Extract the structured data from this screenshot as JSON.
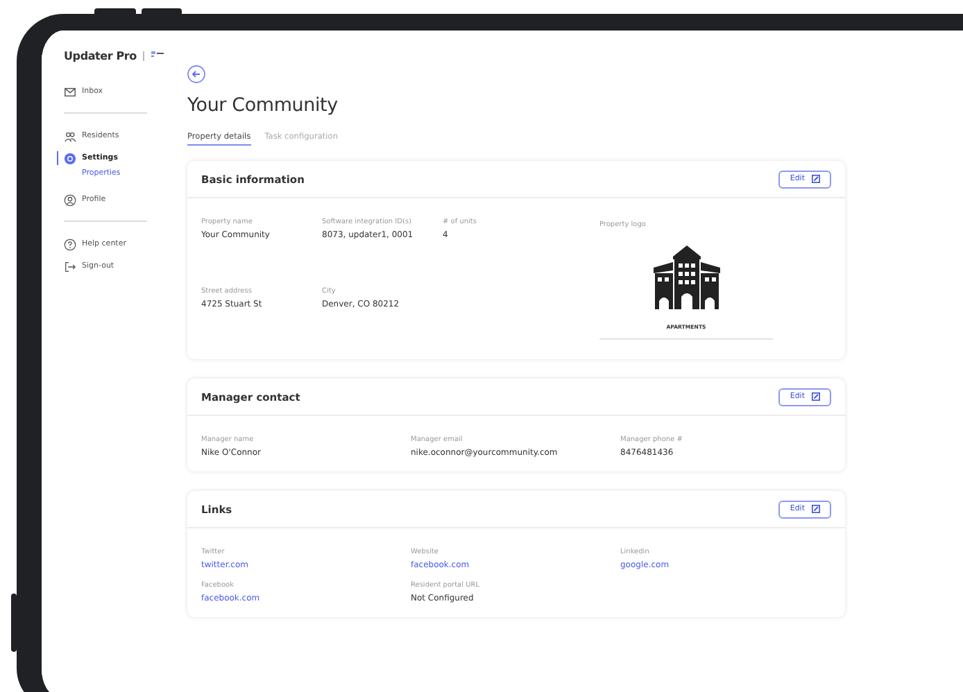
{
  "app": {
    "name": "Updater Pro"
  },
  "sidebar": {
    "groups": [
      [
        {
          "kind": "mail",
          "label": "Inbox",
          "selected": false
        }
      ],
      [
        {
          "kind": "people",
          "label": "Residents",
          "selected": false
        },
        {
          "kind": "gear",
          "label": "Settings",
          "selected": true,
          "children": [
            {
              "label": "Properties",
              "selected": true
            }
          ]
        },
        {
          "kind": "person",
          "label": "Profile",
          "selected": false
        }
      ],
      [
        {
          "kind": "help",
          "label": "Help center",
          "selected": false
        },
        {
          "kind": "signout",
          "label": "Sign-out",
          "selected": false
        }
      ]
    ]
  },
  "page": {
    "title": "Your Community",
    "tabs": [
      {
        "label": "Property details",
        "selected": true
      },
      {
        "label": "Task configuration",
        "selected": false
      }
    ],
    "cards": [
      {
        "title": "Basic information",
        "edit_label": "Edit",
        "rows": [
          [
            {
              "label": "Property name",
              "value": "Your Community",
              "kind": "text"
            },
            {
              "label": "Software integration ID(s)",
              "value": "8073, updater1, 0001",
              "kind": "text"
            },
            {
              "label": "# of units",
              "value": "4",
              "kind": "text"
            }
          ],
          [
            {
              "label": "Street address",
              "value": "4725 Stuart St",
              "kind": "text"
            },
            {
              "label": "City",
              "value": "Denver, CO 80212",
              "kind": "text"
            }
          ]
        ],
        "logo": {
          "label": "Property logo",
          "caption": "APARTMENTS"
        }
      },
      {
        "title": "Manager contact",
        "edit_label": "Edit",
        "rows": [
          [
            {
              "label": "Manager name",
              "value": "Nike O'Connor",
              "kind": "text"
            },
            {
              "label": "Manager email",
              "value": "nike.oconnor@yourcommunity.com",
              "kind": "text"
            },
            {
              "label": "Manager phone #",
              "value": "8476481436",
              "kind": "text"
            }
          ]
        ]
      },
      {
        "title": "Links",
        "edit_label": "Edit",
        "rows": [
          [
            {
              "label": "Twitter",
              "value": "twitter.com",
              "kind": "link"
            },
            {
              "label": "Website",
              "value": "facebook.com",
              "kind": "link"
            },
            {
              "label": "Linkedin",
              "value": "google.com",
              "kind": "link"
            }
          ],
          [
            {
              "label": "Facebook",
              "value": "facebook.com",
              "kind": "link"
            },
            {
              "label": "Resident portal URL",
              "value": "Not Configured",
              "kind": "text"
            }
          ]
        ]
      }
    ]
  }
}
